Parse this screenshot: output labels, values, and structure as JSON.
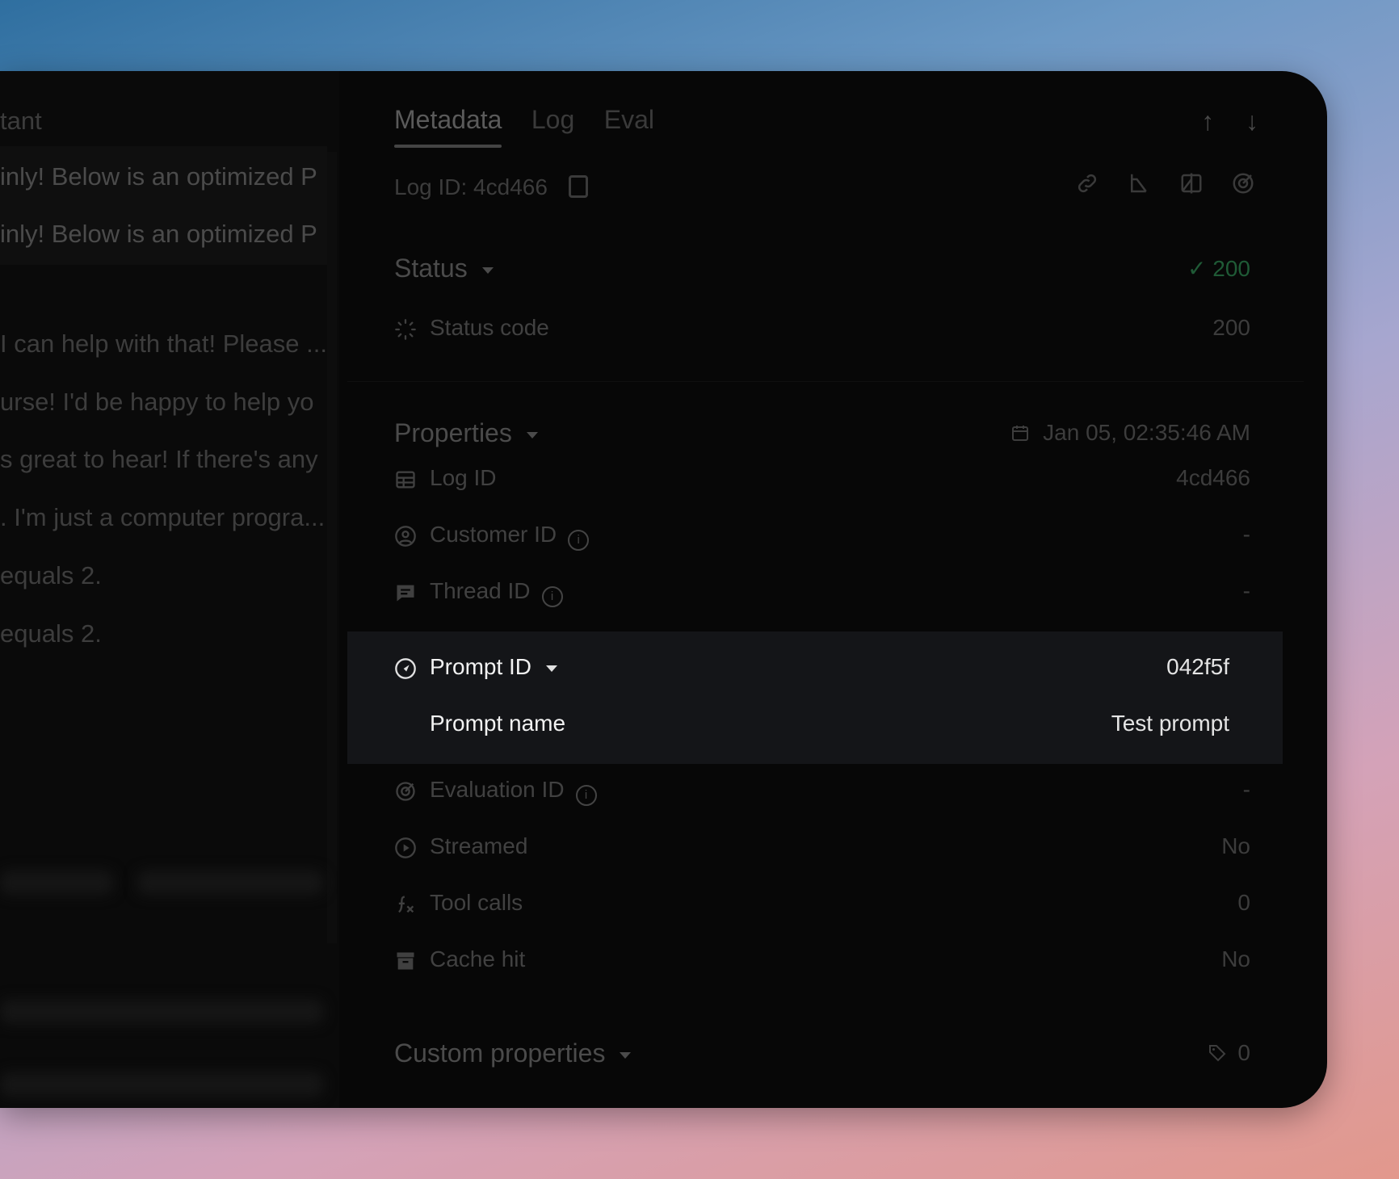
{
  "left_pane": {
    "title": "tant",
    "chips": [
      "inly! Below is an optimized P",
      "inly! Below is an optimized P"
    ],
    "messages": [
      "I can help with that! Please ...",
      "urse! I'd be happy to help yo",
      "s great to hear! If there's any",
      ". I'm just a computer progra...",
      "equals 2.",
      "equals 2."
    ]
  },
  "tabs": [
    {
      "label": "Metadata",
      "active": true
    },
    {
      "label": "Log",
      "active": false
    },
    {
      "label": "Eval",
      "active": false
    }
  ],
  "log_id_line": "Log ID: 4cd466",
  "status": {
    "title": "Status",
    "summary": "200",
    "status_code_label": "Status code",
    "status_code_value": "200"
  },
  "properties": {
    "title": "Properties",
    "timestamp": "Jan 05, 02:35:46 AM",
    "rows": {
      "log_id": {
        "label": "Log ID",
        "value": "4cd466"
      },
      "customer_id": {
        "label": "Customer ID",
        "value": "-"
      },
      "thread_id": {
        "label": "Thread ID",
        "value": "-"
      },
      "prompt_id": {
        "label": "Prompt ID",
        "value": "042f5f"
      },
      "prompt_name": {
        "label": "Prompt name",
        "value": "Test prompt"
      },
      "evaluation_id": {
        "label": "Evaluation ID",
        "value": "-"
      },
      "streamed": {
        "label": "Streamed",
        "value": "No"
      },
      "tool_calls": {
        "label": "Tool calls",
        "value": "0"
      },
      "cache_hit": {
        "label": "Cache hit",
        "value": "No"
      }
    }
  },
  "custom_properties": {
    "title": "Custom properties",
    "count": "0"
  },
  "colors": {
    "status_ok": "#1f5a36",
    "highlight_bg": "#141518",
    "panel_bg": "#070707"
  }
}
